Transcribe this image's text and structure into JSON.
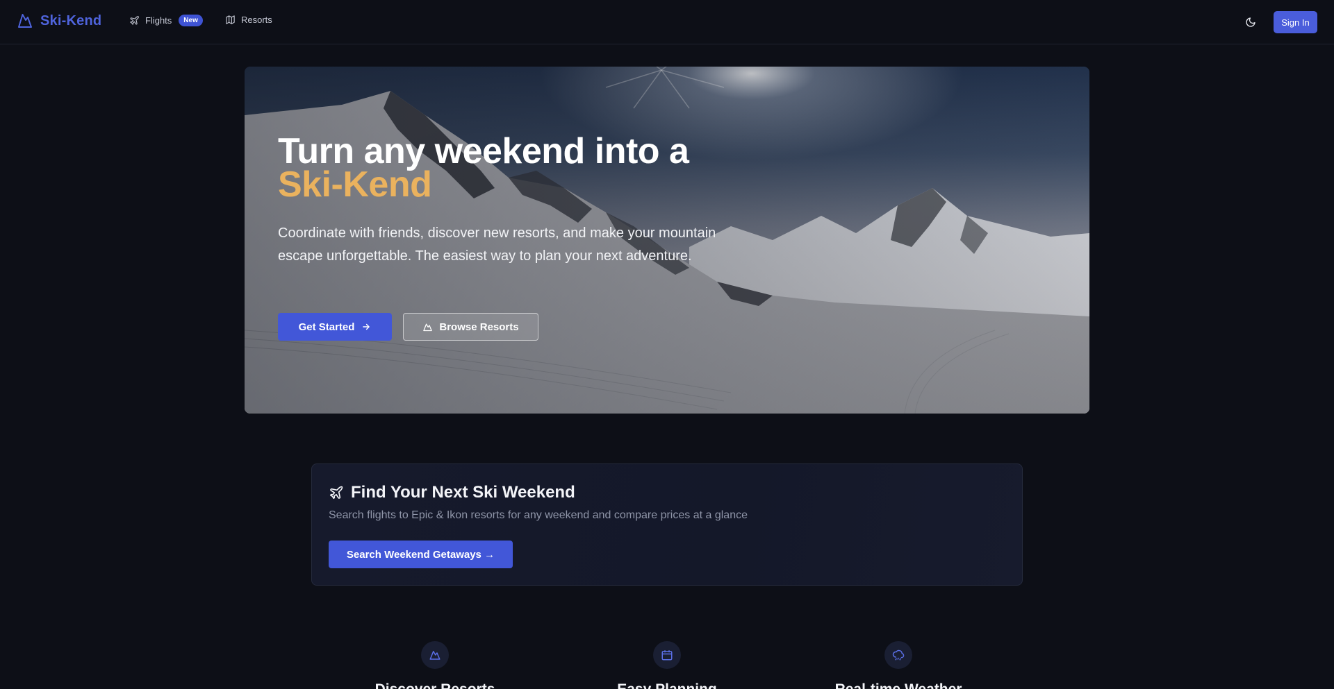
{
  "nav": {
    "brand": "Ski-Kend",
    "links": [
      {
        "label": "Flights",
        "icon": "plane-icon",
        "badge": "New"
      },
      {
        "label": "Resorts",
        "icon": "map-icon"
      }
    ],
    "theme_icon": "moon-icon",
    "signin_label": "Sign In"
  },
  "hero": {
    "title_line1": "Turn any weekend into a",
    "title_accent": "Ski-Kend",
    "subtitle": "Coordinate with friends, discover new resorts, and make your mountain escape unforgettable. The easiest way to plan your next adventure.",
    "primary_label": "Get Started",
    "secondary_label": "Browse Resorts"
  },
  "search_card": {
    "title": "Find Your Next Ski Weekend",
    "subtitle": "Search flights to Epic & Ikon resorts for any weekend and compare prices at a glance",
    "button_label": "Search Weekend Getaways →"
  },
  "features": [
    {
      "title": "Discover Resorts",
      "icon": "mountain-icon"
    },
    {
      "title": "Easy Planning",
      "icon": "calendar-icon"
    },
    {
      "title": "Real-time Weather",
      "icon": "cloud-rain-icon"
    }
  ],
  "colors": {
    "accent": "#4a5ddb",
    "brand": "#4f64dd",
    "hero_accent": "#eab25e",
    "background": "#0d0f17"
  }
}
